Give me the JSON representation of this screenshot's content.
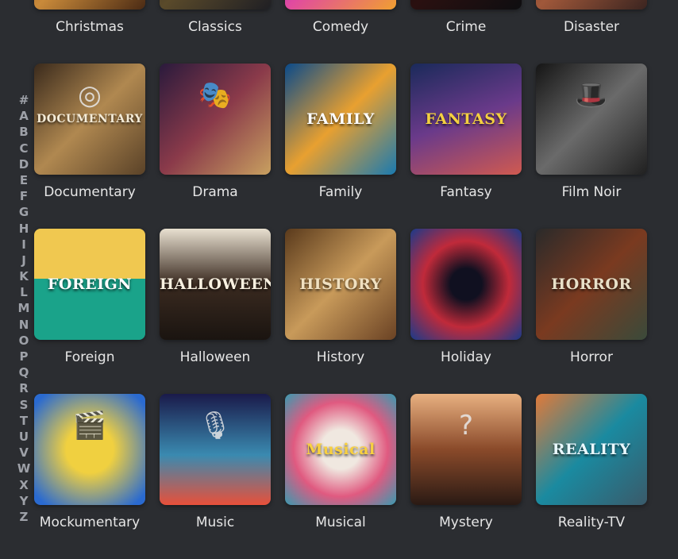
{
  "alphabet": [
    "#",
    "A",
    "B",
    "C",
    "D",
    "E",
    "F",
    "G",
    "H",
    "I",
    "J",
    "K",
    "L",
    "M",
    "N",
    "O",
    "P",
    "Q",
    "R",
    "S",
    "T",
    "U",
    "V",
    "W",
    "X",
    "Y",
    "Z"
  ],
  "genres": [
    {
      "label": "Christmas",
      "name": "christmas",
      "bg": "linear-gradient(135deg,#7a3a1a,#c98a3a,#4a2a14)",
      "art": "",
      "glyph": ""
    },
    {
      "label": "Classics",
      "name": "classics",
      "bg": "linear-gradient(135deg,#1f1f24,#5a4a2a,#1f1f24)",
      "art": "",
      "glyph": ""
    },
    {
      "label": "Comedy",
      "name": "comedy",
      "bg": "linear-gradient(135deg,#4a2ad0,#e14aa0,#f0a030)",
      "art": "",
      "glyph": ""
    },
    {
      "label": "Crime",
      "name": "crime",
      "bg": "linear-gradient(135deg,#0e0e10,#2a1010,#0e0e10)",
      "art": "",
      "glyph": ""
    },
    {
      "label": "Disaster",
      "name": "disaster",
      "bg": "linear-gradient(135deg,#5a3326,#a0583a,#3a2420)",
      "art": "",
      "glyph": ""
    },
    {
      "label": "Documentary",
      "name": "documentary",
      "bg": "linear-gradient(135deg,#3a2a1c,#b08850,#5a4228)",
      "art": "DOCUMENTARY",
      "glyph": "◎",
      "artColor": "#f5ecd8"
    },
    {
      "label": "Drama",
      "name": "drama",
      "bg": "linear-gradient(135deg,#2a1a3c,#8a3a4a,#c8a060)",
      "art": "",
      "glyph": "🎭"
    },
    {
      "label": "Family",
      "name": "family",
      "bg": "linear-gradient(135deg,#0a4a8a,#e8a030,#1a7ab0)",
      "art": "FAMILY",
      "glyph": "",
      "artColor": "#ffffff"
    },
    {
      "label": "Fantasy",
      "name": "fantasy",
      "bg": "linear-gradient(160deg,#1a2a5a,#6a3a8a,#d05a50)",
      "art": "FANTASY",
      "glyph": "",
      "artColor": "#f4d040"
    },
    {
      "label": "Film Noir",
      "name": "film-noir",
      "bg": "linear-gradient(135deg,#151515,#6a6a6a,#202020)",
      "art": "",
      "glyph": "🎩"
    },
    {
      "label": "Foreign",
      "name": "foreign",
      "bg": "linear-gradient(180deg,#f0c850 0%,#f0c850 45%,#1aa38a 45%,#1aa38a 100%)",
      "art": "FOREIGN",
      "glyph": "",
      "artColor": "#ffffff"
    },
    {
      "label": "Halloween",
      "name": "halloween",
      "bg": "linear-gradient(180deg,#e8e0d0,#3a2a20,#1a1410)",
      "art": "HALLOWEEN",
      "glyph": "",
      "artColor": "#f8f0e0"
    },
    {
      "label": "History",
      "name": "history",
      "bg": "linear-gradient(135deg,#5a3a1c,#c89a5a,#6a4224)",
      "art": "HISTORY",
      "glyph": "",
      "artColor": "#f0e0c0"
    },
    {
      "label": "Holiday",
      "name": "holiday",
      "bg": "radial-gradient(circle,#101020 20%,#c02a3a 55%,#1a3a8a 100%)",
      "art": "",
      "glyph": ""
    },
    {
      "label": "Horror",
      "name": "horror",
      "bg": "linear-gradient(135deg,#2a2a2a,#7a3a20,#3a4a3a)",
      "art": "HORROR",
      "glyph": "",
      "artColor": "#e8e0c8"
    },
    {
      "label": "Mockumentary",
      "name": "mockumentary",
      "bg": "radial-gradient(circle,#f0d040 30%,#2a6ad0 90%)",
      "art": "",
      "glyph": "🎬"
    },
    {
      "label": "Music",
      "name": "music",
      "bg": "linear-gradient(180deg,#1a1a4a,#3a8ab0 55%,#e8503a 100%)",
      "art": "",
      "glyph": "🎙"
    },
    {
      "label": "Musical",
      "name": "musical",
      "bg": "radial-gradient(circle,#f0e8e0 25%,#e05a80 60%,#3a9ab0 100%)",
      "art": "Musical",
      "glyph": "",
      "artColor": "#f8d040"
    },
    {
      "label": "Mystery",
      "name": "mystery",
      "bg": "linear-gradient(180deg,#e8b080,#8a4a2a,#2a1a14)",
      "art": "",
      "glyph": "?"
    },
    {
      "label": "Reality-TV",
      "name": "reality-tv",
      "bg": "linear-gradient(135deg,#e07a3a,#1a8aa0,#3a5a6a)",
      "art": "REALITY",
      "glyph": "",
      "artColor": "#e8f8ff"
    }
  ]
}
